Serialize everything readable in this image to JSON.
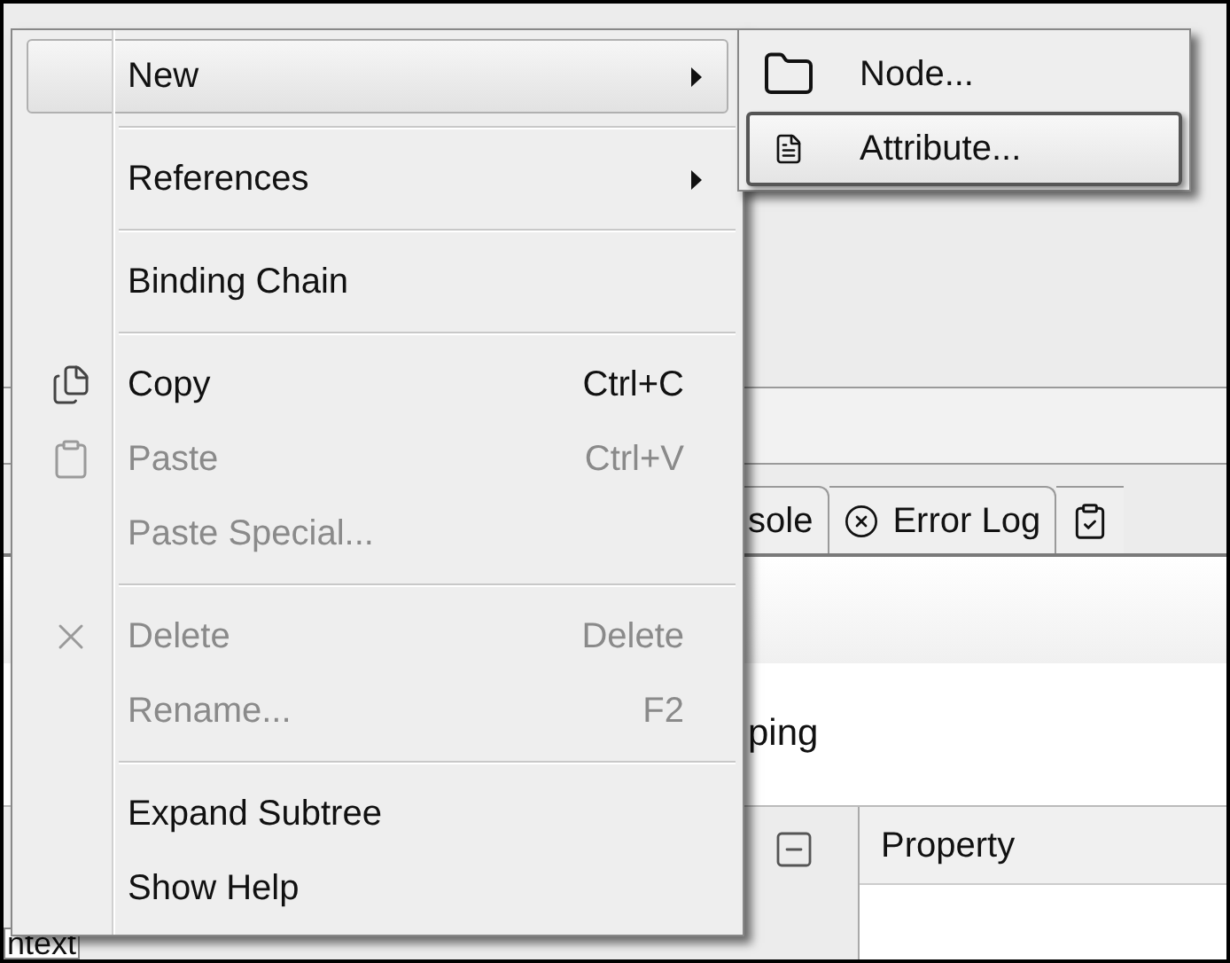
{
  "background": {
    "tabs": [
      {
        "label": "sole"
      },
      {
        "label": "Error Log"
      }
    ],
    "label_text": "ping",
    "table_header": "Property",
    "left_label": "ntext"
  },
  "menu": {
    "items": [
      {
        "kind": "submenu",
        "label": "New",
        "selected": true,
        "disabled": false
      },
      {
        "kind": "separator"
      },
      {
        "kind": "submenu",
        "label": "References",
        "selected": false,
        "disabled": false
      },
      {
        "kind": "separator"
      },
      {
        "kind": "item",
        "label": "Binding Chain",
        "selected": false,
        "disabled": false
      },
      {
        "kind": "separator"
      },
      {
        "kind": "item",
        "label": "Copy",
        "shortcut": "Ctrl+C",
        "selected": false,
        "disabled": false
      },
      {
        "kind": "item",
        "label": "Paste",
        "shortcut": "Ctrl+V",
        "selected": false,
        "disabled": true
      },
      {
        "kind": "item",
        "label": "Paste Special...",
        "selected": false,
        "disabled": true
      },
      {
        "kind": "separator"
      },
      {
        "kind": "item",
        "label": "Delete",
        "shortcut": "Delete",
        "selected": false,
        "disabled": true
      },
      {
        "kind": "item",
        "label": "Rename...",
        "shortcut": "F2",
        "selected": false,
        "disabled": true
      },
      {
        "kind": "separator"
      },
      {
        "kind": "item",
        "label": "Expand Subtree",
        "selected": false,
        "disabled": false
      },
      {
        "kind": "item",
        "label": "Show Help",
        "selected": false,
        "disabled": false
      }
    ]
  },
  "submenu": {
    "items": [
      {
        "label": "Node...",
        "selected": false
      },
      {
        "label": "Attribute...",
        "selected": true
      }
    ]
  }
}
